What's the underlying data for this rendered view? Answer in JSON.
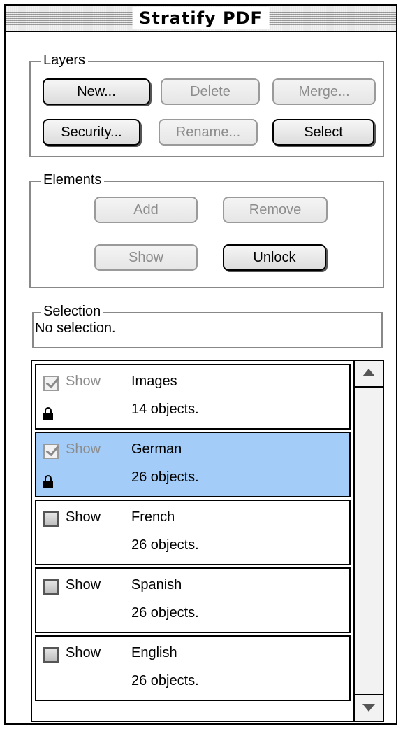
{
  "window": {
    "title": "Stratify PDF"
  },
  "layers_group": {
    "label": "Layers",
    "buttons": {
      "new": "New...",
      "delete": "Delete",
      "merge": "Merge...",
      "security": "Security...",
      "rename": "Rename...",
      "select": "Select"
    }
  },
  "elements_group": {
    "label": "Elements",
    "buttons": {
      "add": "Add",
      "remove": "Remove",
      "show": "Show",
      "unlock": "Unlock"
    }
  },
  "selection": {
    "label": "Selection",
    "text": "No selection."
  },
  "layer_list": [
    {
      "show_label": "Show",
      "name": "Images",
      "count": "14 objects.",
      "checked": true,
      "locked": true,
      "selected": false
    },
    {
      "show_label": "Show",
      "name": "German",
      "count": "26 objects.",
      "checked": true,
      "locked": true,
      "selected": true
    },
    {
      "show_label": "Show",
      "name": "French",
      "count": "26 objects.",
      "checked": false,
      "locked": false,
      "selected": false
    },
    {
      "show_label": "Show",
      "name": "Spanish",
      "count": "26 objects.",
      "checked": false,
      "locked": false,
      "selected": false
    },
    {
      "show_label": "Show",
      "name": "English",
      "count": "26 objects.",
      "checked": false,
      "locked": false,
      "selected": false
    }
  ],
  "icons": {
    "lock": "lock-icon",
    "checkbox_check": "checkmark-icon",
    "scroll_up": "arrow-up-icon",
    "scroll_down": "arrow-down-icon"
  },
  "colors": {
    "selected_row": "#a3cdf8",
    "disabled_text": "#8c8c8c"
  }
}
